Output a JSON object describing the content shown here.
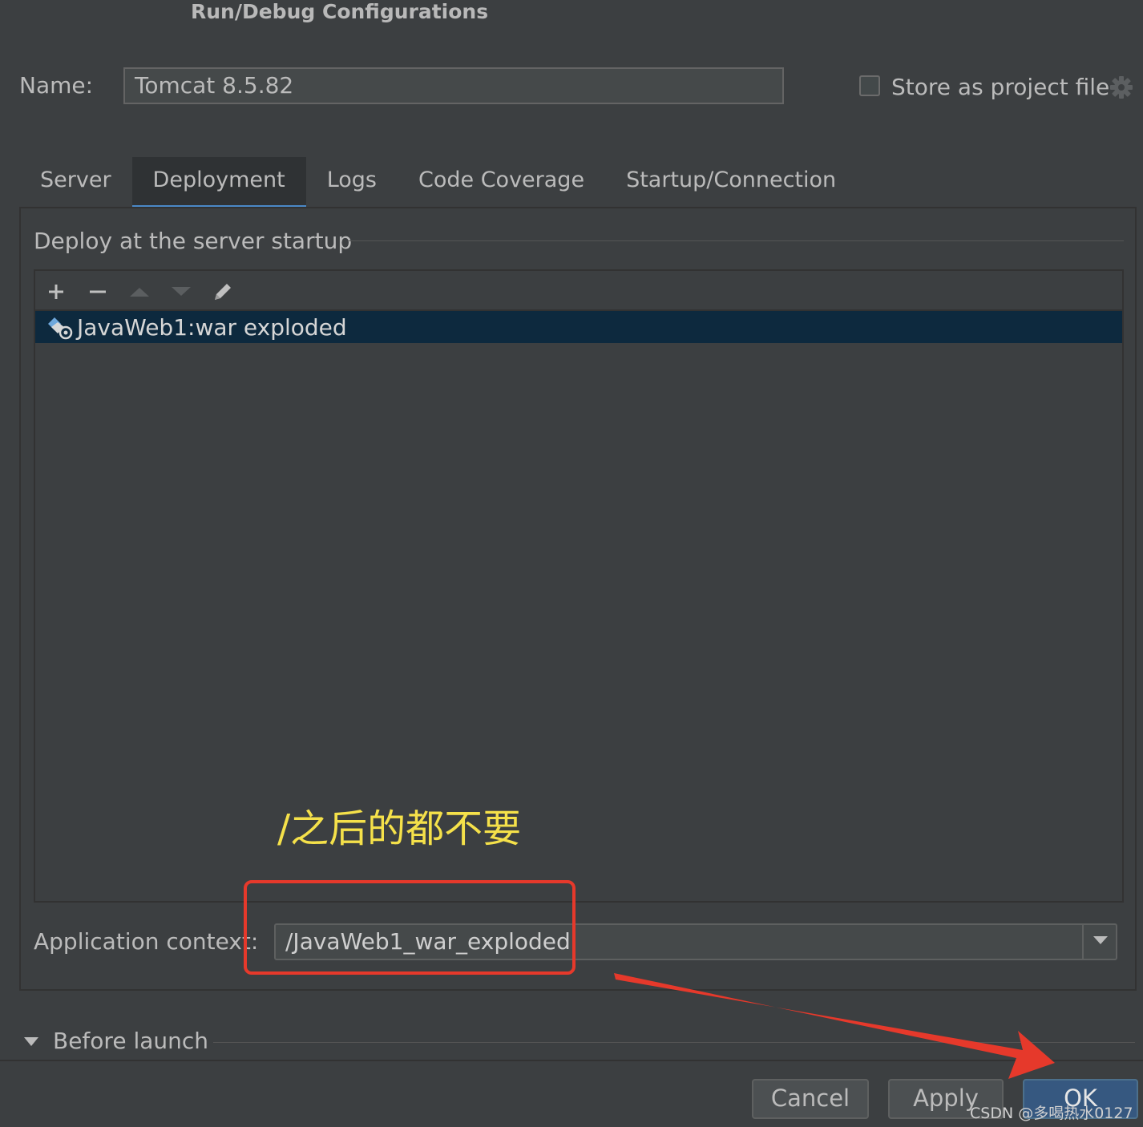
{
  "window": {
    "title": "Run/Debug Configurations"
  },
  "name": {
    "label": "Name:",
    "value": "Tomcat 8.5.82"
  },
  "store": {
    "label": "Store as project file",
    "checked": false,
    "icon": "gear-icon"
  },
  "tabs": [
    {
      "label": "Server",
      "active": false
    },
    {
      "label": "Deployment",
      "active": true
    },
    {
      "label": "Logs",
      "active": false
    },
    {
      "label": "Code Coverage",
      "active": false
    },
    {
      "label": "Startup/Connection",
      "active": false
    }
  ],
  "deploy": {
    "section_title": "Deploy at the server startup",
    "toolbar": [
      "plus-icon",
      "minus-icon",
      "arrow-up-icon",
      "arrow-down-icon",
      "edit-icon"
    ],
    "items": [
      {
        "label": "JavaWeb1:war exploded",
        "selected": true,
        "icon": "artifact-icon"
      }
    ]
  },
  "annotation": {
    "text": "/之后的都不要",
    "color": "#f5e14a",
    "highlight_color": "#e6392b"
  },
  "app_context": {
    "label": "Application context:",
    "value": "/JavaWeb1_war_exploded"
  },
  "before_launch": {
    "label": "Before launch"
  },
  "buttons": {
    "cancel": "Cancel",
    "apply": "Apply",
    "ok": "OK"
  },
  "watermark": "CSDN @多喝热水0127",
  "colors": {
    "accent": "#4a88c7",
    "selection": "#0d293e",
    "ok_button": "#365880",
    "arrow": "#e6392b"
  }
}
